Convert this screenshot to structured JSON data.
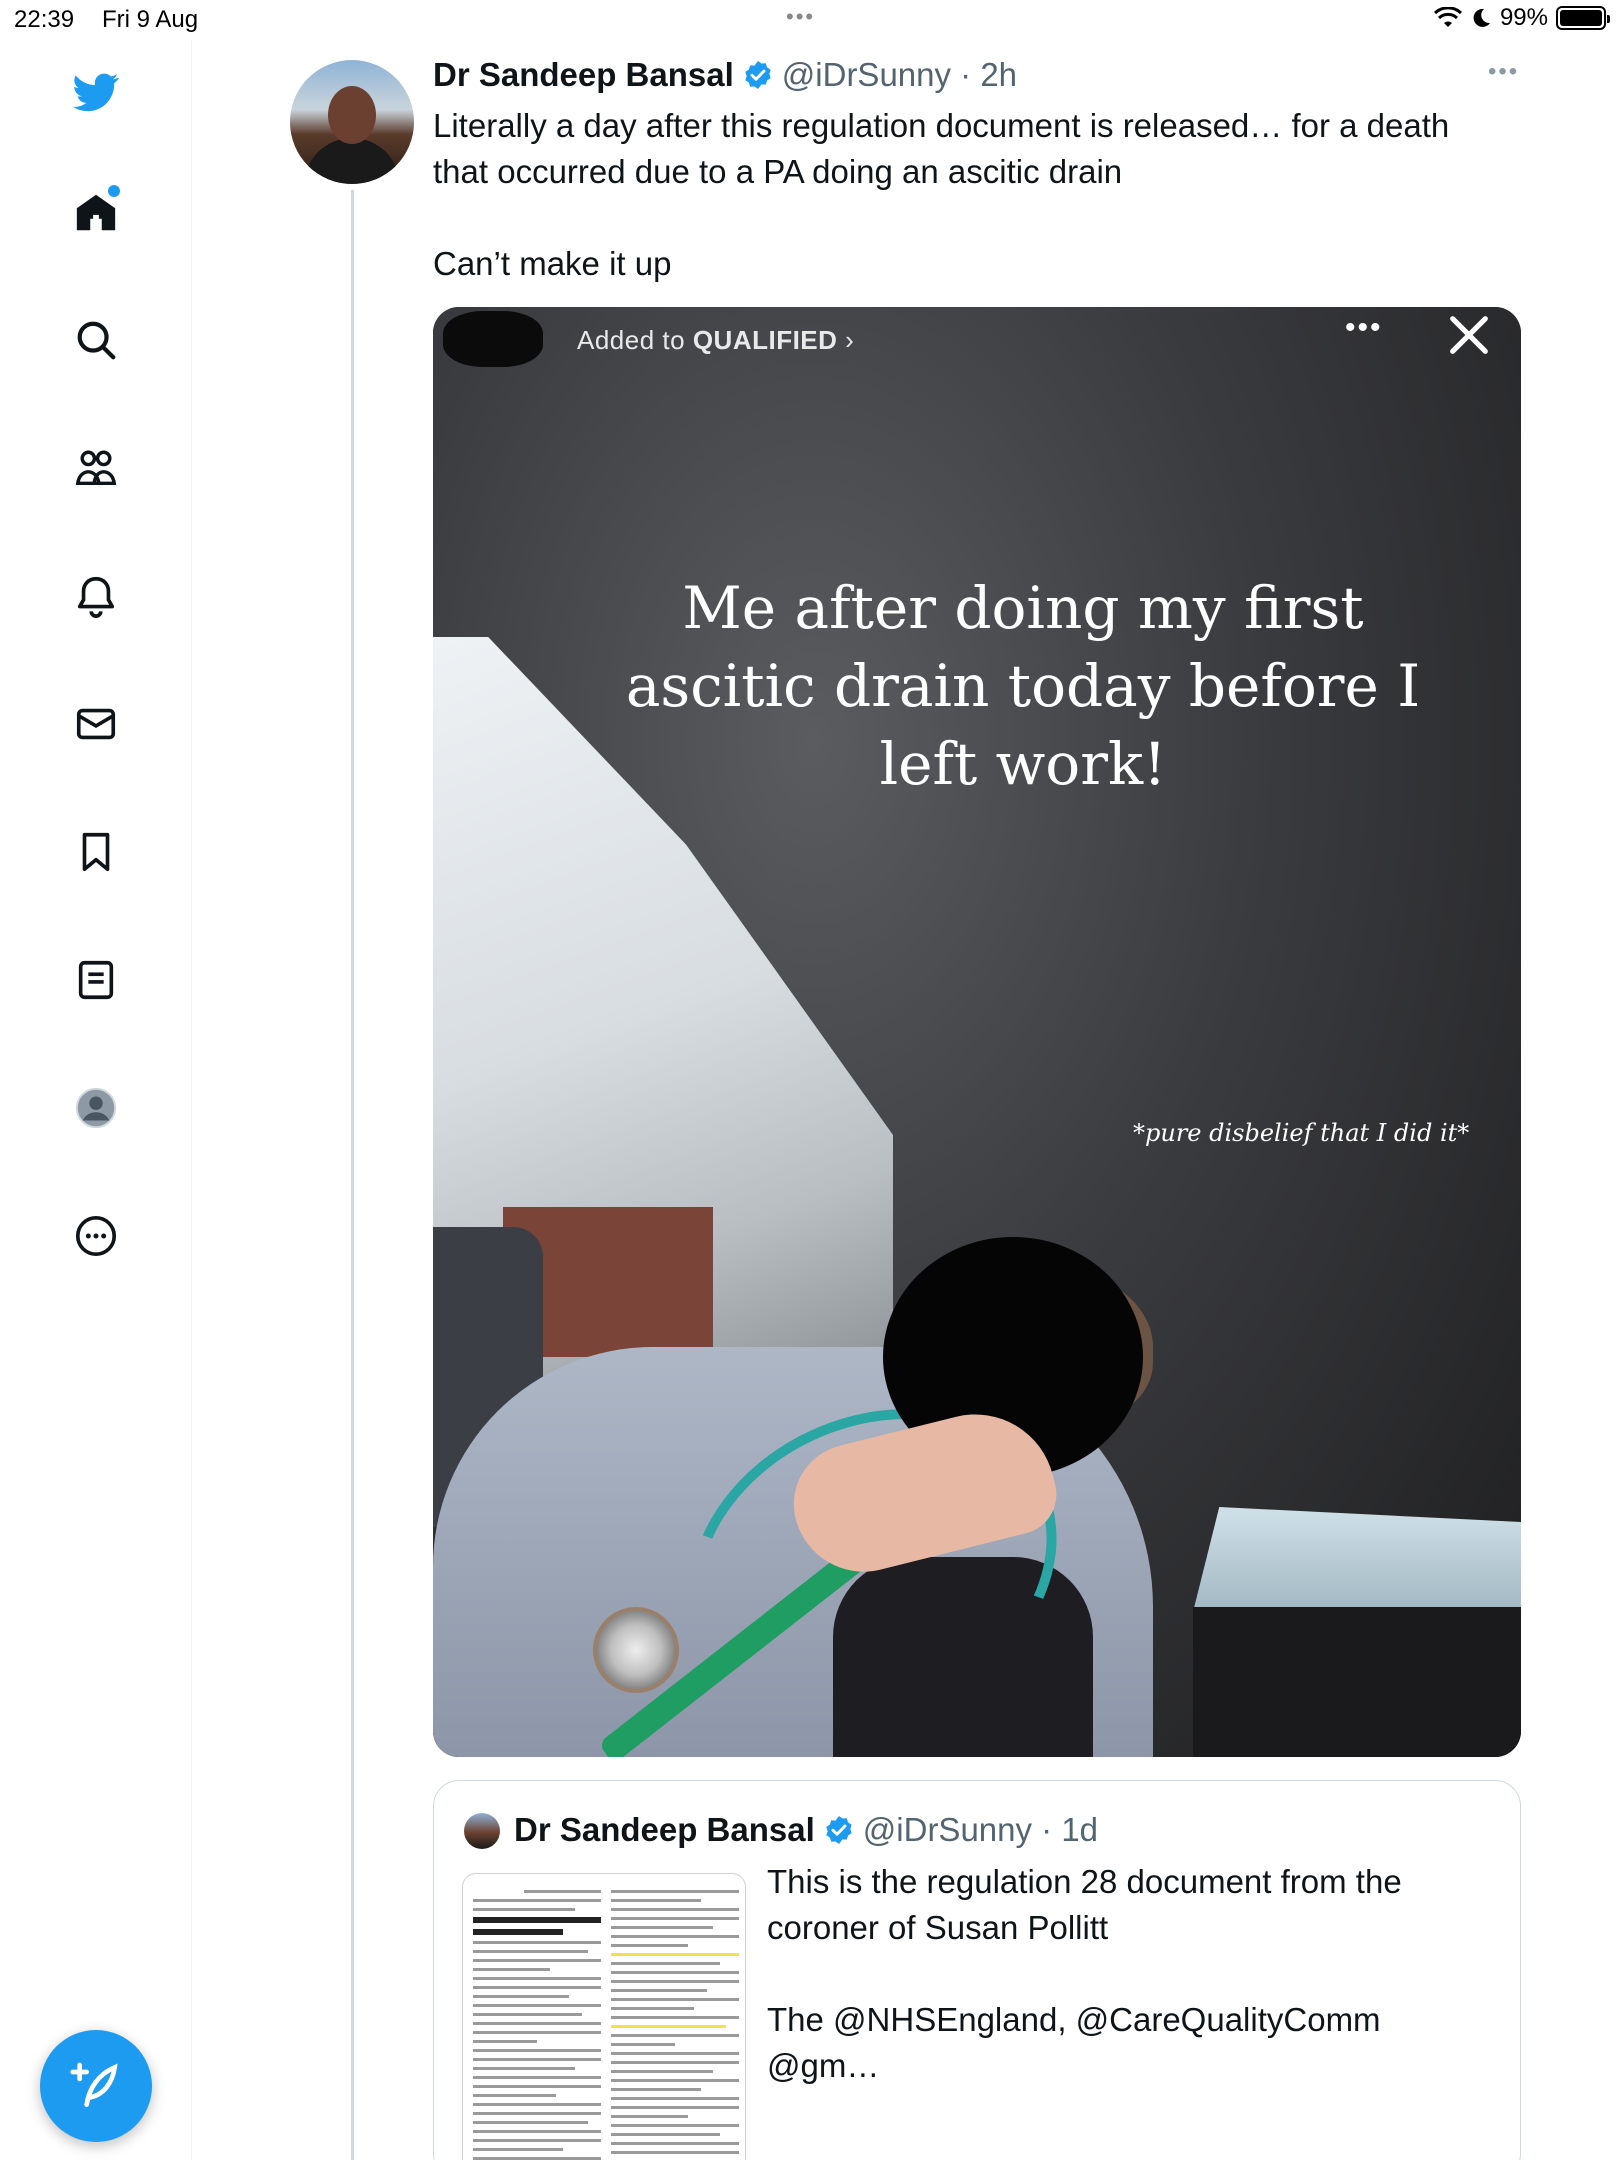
{
  "status_bar": {
    "time": "22:39",
    "date": "Fri 9 Aug",
    "battery": "99%"
  },
  "sidebar": {
    "items": [
      {
        "name": "twitter-logo",
        "icon": "bird-icon"
      },
      {
        "name": "home",
        "icon": "home-icon",
        "has_notification_dot": true
      },
      {
        "name": "explore",
        "icon": "search-icon"
      },
      {
        "name": "communities",
        "icon": "people-icon"
      },
      {
        "name": "notifications",
        "icon": "bell-icon"
      },
      {
        "name": "messages",
        "icon": "mail-icon"
      },
      {
        "name": "bookmarks",
        "icon": "bookmark-icon"
      },
      {
        "name": "lists",
        "icon": "list-icon"
      },
      {
        "name": "profile",
        "icon": "profile-icon"
      },
      {
        "name": "more",
        "icon": "more-circle-icon"
      }
    ],
    "compose_icon": "feather-plus-icon"
  },
  "tweet": {
    "author_name": "Dr Sandeep Bansal",
    "handle_time": "@iDrSunny · 2h",
    "text_line1": "Literally a day after this regulation document is released… for a death that occurred due to a PA doing an ascitic drain",
    "text_line2": "Can’t make it up",
    "media": {
      "story_label_prefix": "Added to ",
      "story_label_bold": "QUALIFIED",
      "story_label_suffix": " ›",
      "caption": "Me after doing my first ascitic drain today before I left work!",
      "subcaption": "*pure disbelief that I did it*"
    }
  },
  "quoted_tweet": {
    "author_name": "Dr Sandeep Bansal",
    "handle_time": "@iDrSunny · 1d",
    "text_line1": "This is the regulation 28 document from the coroner of Susan Pollitt",
    "text_line2": "The @NHSEngland, @CareQualityComm @gm…"
  },
  "colors": {
    "accent": "#1d9bf0",
    "text": "#0f1419",
    "secondary_text": "#536471",
    "border": "#cfd9de"
  }
}
